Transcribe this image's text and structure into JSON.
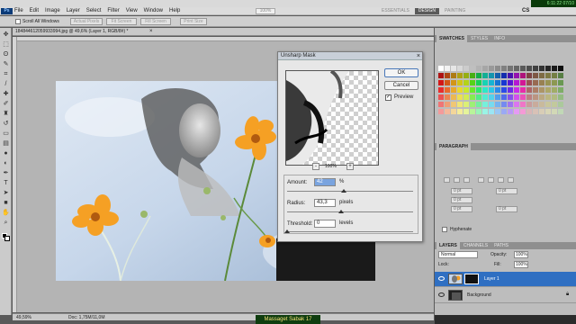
{
  "app": {
    "logo": "Ps",
    "clock": "6:11:22 07/10"
  },
  "menu": {
    "items": [
      "File",
      "Edit",
      "Image",
      "Layer",
      "Select",
      "Filter",
      "View",
      "Window",
      "Help"
    ],
    "zoom_value": "100%"
  },
  "workspace": {
    "items": [
      "ESSENTIALS",
      "DESIGN",
      "PAINTING"
    ],
    "active": "DESIGN",
    "cs_live": "CS"
  },
  "options_bar": {
    "scroll_all_windows": "Scroll All Windows",
    "buttons": [
      "Actual Pixels",
      "Fit Screen",
      "Fill Screen",
      "Print Size"
    ]
  },
  "document": {
    "tab_title": "184844612059933994.jpg @ 49,6% (Layer 1, RGB/8#) *",
    "close": "×",
    "status_zoom": "49,59%",
    "status_doc": "Doc: 1,75M/11,0M"
  },
  "caption": "Massaget Sabak 17",
  "dialog": {
    "title": "Unsharp Mask",
    "close": "×",
    "ok": "OK",
    "cancel": "Cancel",
    "preview_label": "Preview",
    "preview_checked": "✓",
    "zoom_out": "-",
    "zoom_in": "+",
    "zoom_pct": "100%",
    "amount_label": "Amount:",
    "amount_value": "42",
    "amount_unit": "%",
    "amount_pct": 0.45,
    "radius_label": "Radius:",
    "radius_value": "43,3",
    "radius_unit": "pixels",
    "radius_pct": 0.43,
    "threshold_label": "Threshold:",
    "threshold_value": "0",
    "threshold_unit": "levels",
    "threshold_pct": 0.0
  },
  "panels": {
    "swatch_tabs": [
      "SWATCHES",
      "STYLES",
      "INFO"
    ],
    "paragraph_tabs": [
      "PARAGRAPH"
    ],
    "para_fields": [
      "0 pt",
      "0 pt",
      "0 pt",
      "0 pt",
      "0 pt",
      "0 pt",
      "0 pt",
      "0 pt"
    ],
    "hyphenate": "Hyphenate",
    "layers_tabs": [
      "LAYERS",
      "CHANNELS",
      "PATHS"
    ],
    "blend_mode": "Normal",
    "opacity_label": "Opacity:",
    "opacity_value": "100%",
    "lock_label": "Lock:",
    "fill_label": "Fill:",
    "fill_value": "100%",
    "layers": [
      {
        "name": "Layer 1",
        "selected": true
      },
      {
        "name": "Background",
        "selected": false
      }
    ]
  },
  "colors": {
    "accent": "#2f6fc2",
    "flower": "#f5a024",
    "sky": "#c9d9ec"
  }
}
